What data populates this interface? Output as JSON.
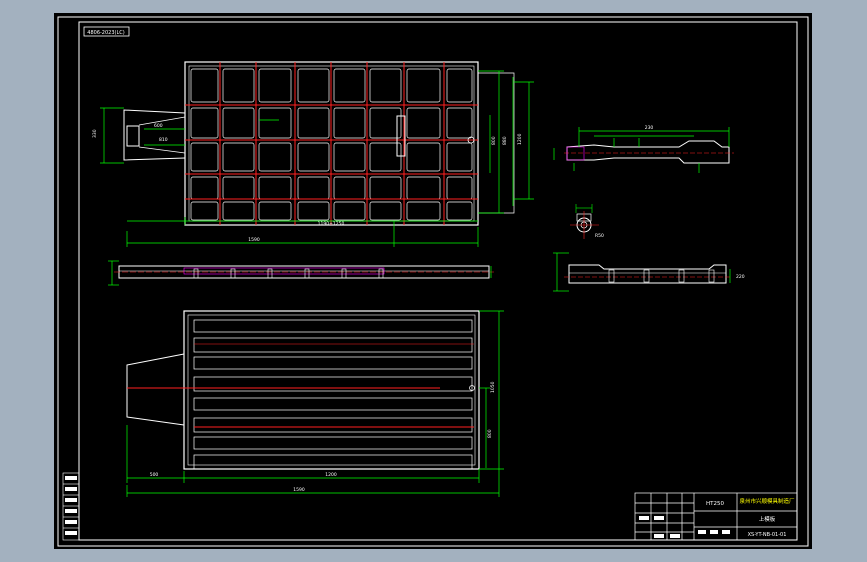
{
  "colors": {
    "background": "#a3b1bf",
    "canvas": "#000000",
    "frame": "#ffffff",
    "outline": "#ffffff",
    "dimension": "#00ff00",
    "centerline": "#ff2020",
    "hatch": "#ff00ff",
    "text": "#ffffff",
    "title_text": "#ffff00"
  },
  "stamp": {
    "label": "4806-2023(LC)"
  },
  "dims": {
    "top_view_total": "1590",
    "top_view_body": "1190+1250",
    "left_a": "330",
    "left_b": "1050",
    "small_a": "810",
    "small_b": "600",
    "small_c": "630",
    "right_a": "1200",
    "right_b": "880",
    "right_c": "800",
    "right_d": "300",
    "bottom_total": "1590",
    "bottom_part": "1200",
    "bottom_left": "500",
    "bottom_h": "1050",
    "bottom_h2": "800",
    "section_w": "230",
    "section_detail": "R50",
    "side_h": "220"
  },
  "title_block": {
    "company": "泉州市兴顺模具制造厂",
    "part_name": "上模板",
    "drawing_no": "XS-YT-NB-01-01",
    "material": "HT250"
  },
  "revision_rows": [
    "",
    "",
    "",
    "",
    "",
    ""
  ]
}
